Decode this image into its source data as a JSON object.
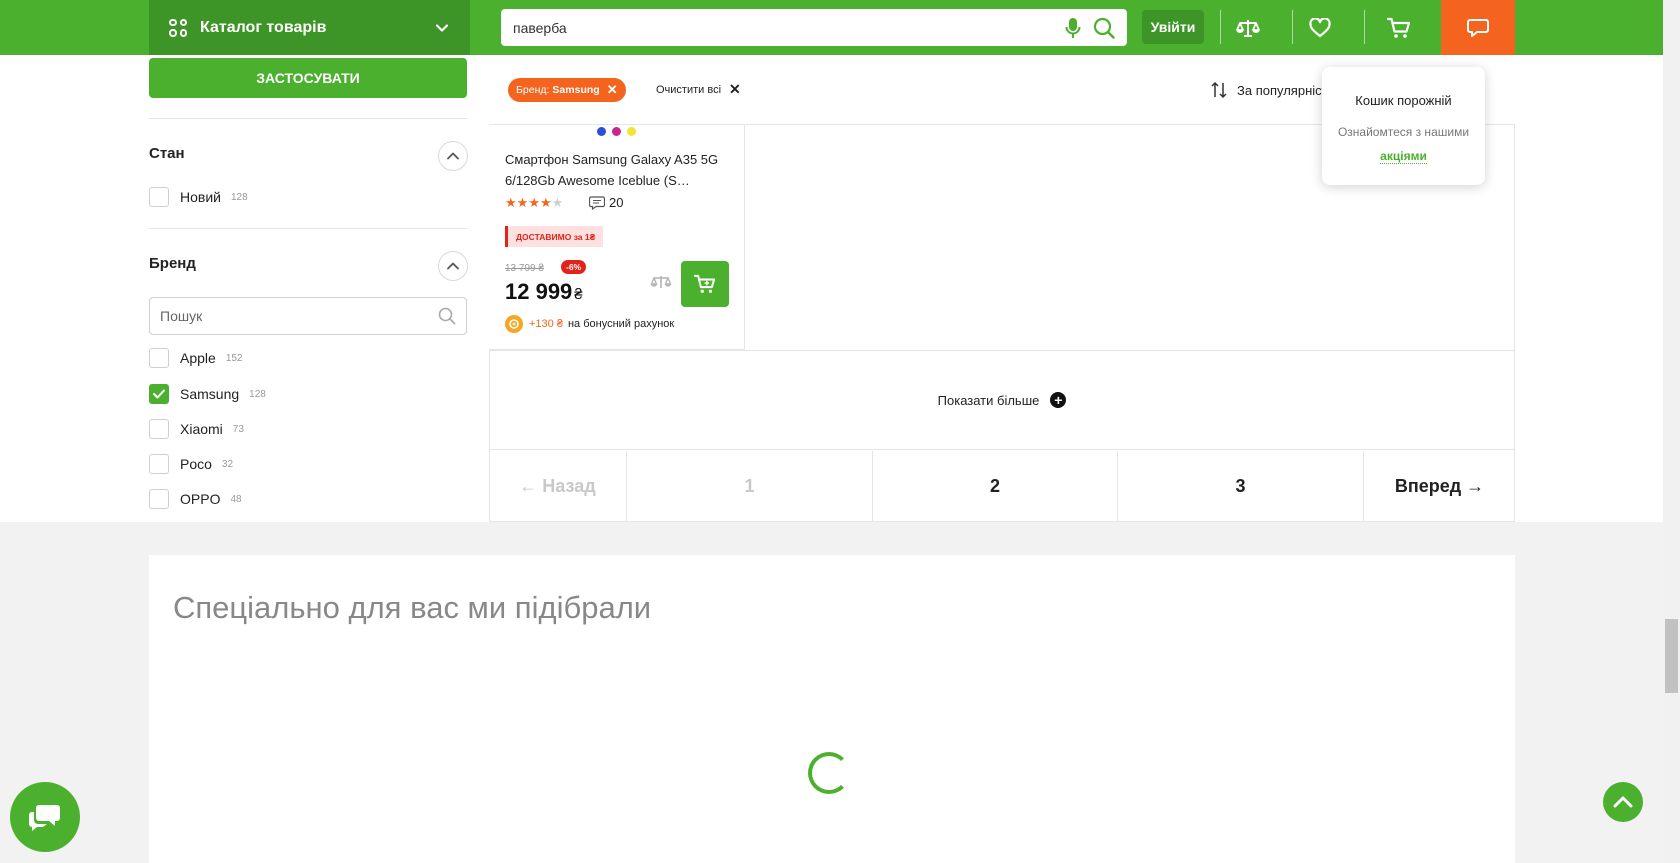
{
  "header": {
    "catalog_label": "Каталог товарів",
    "search_value": "паверба",
    "login_label": "Увійти"
  },
  "sidebar": {
    "apply_label": "ЗАСТОСУВАТИ",
    "condition": {
      "title": "Стан",
      "items": [
        {
          "label": "Новий",
          "count": "128",
          "checked": false
        }
      ]
    },
    "brand": {
      "title": "Бренд",
      "search_placeholder": "Пошук",
      "items": [
        {
          "label": "Apple",
          "count": "152",
          "checked": false
        },
        {
          "label": "Samsung",
          "count": "128",
          "checked": true
        },
        {
          "label": "Xiaomi",
          "count": "73",
          "checked": false
        },
        {
          "label": "Poco",
          "count": "32",
          "checked": false
        },
        {
          "label": "OPPO",
          "count": "48",
          "checked": false
        }
      ]
    }
  },
  "filters": {
    "chip_prefix": "Бренд:",
    "chip_value": "Samsung",
    "clear_all": "Очистити всі",
    "sort_label": "За популярністю"
  },
  "product": {
    "colors": [
      "#2d4fd8",
      "#c8278f",
      "#f0e339"
    ],
    "title": "Смартфон Samsung Galaxy A35 5G 6/128Gb Awesome Iceblue (S…",
    "rating": 4,
    "rating_max": 5,
    "reviews": "20",
    "delivery_badge": "ДОСТАВИМО за 1₴",
    "old_price": "13 799 ₴",
    "discount": "-6%",
    "price": "12 999",
    "currency": "₴",
    "bonus_amount": "+130 ₴",
    "bonus_text": "на бонусний рахунок"
  },
  "show_more": "Показати більше",
  "pagination": {
    "prev": "← Назад",
    "pages": [
      "1",
      "2",
      "3"
    ],
    "next": "Вперед →"
  },
  "cart_popup": {
    "title": "Кошик порожній",
    "text_before": "Ознайомтеся з нашими",
    "link": "акціями"
  },
  "recommendations": {
    "title": "Спеціально для вас ми підібрали"
  },
  "colors": {
    "brand_green": "#4cb02f",
    "dark_green": "#3e9527",
    "accent_orange": "#f5641e",
    "sale_red": "#e2231a"
  }
}
